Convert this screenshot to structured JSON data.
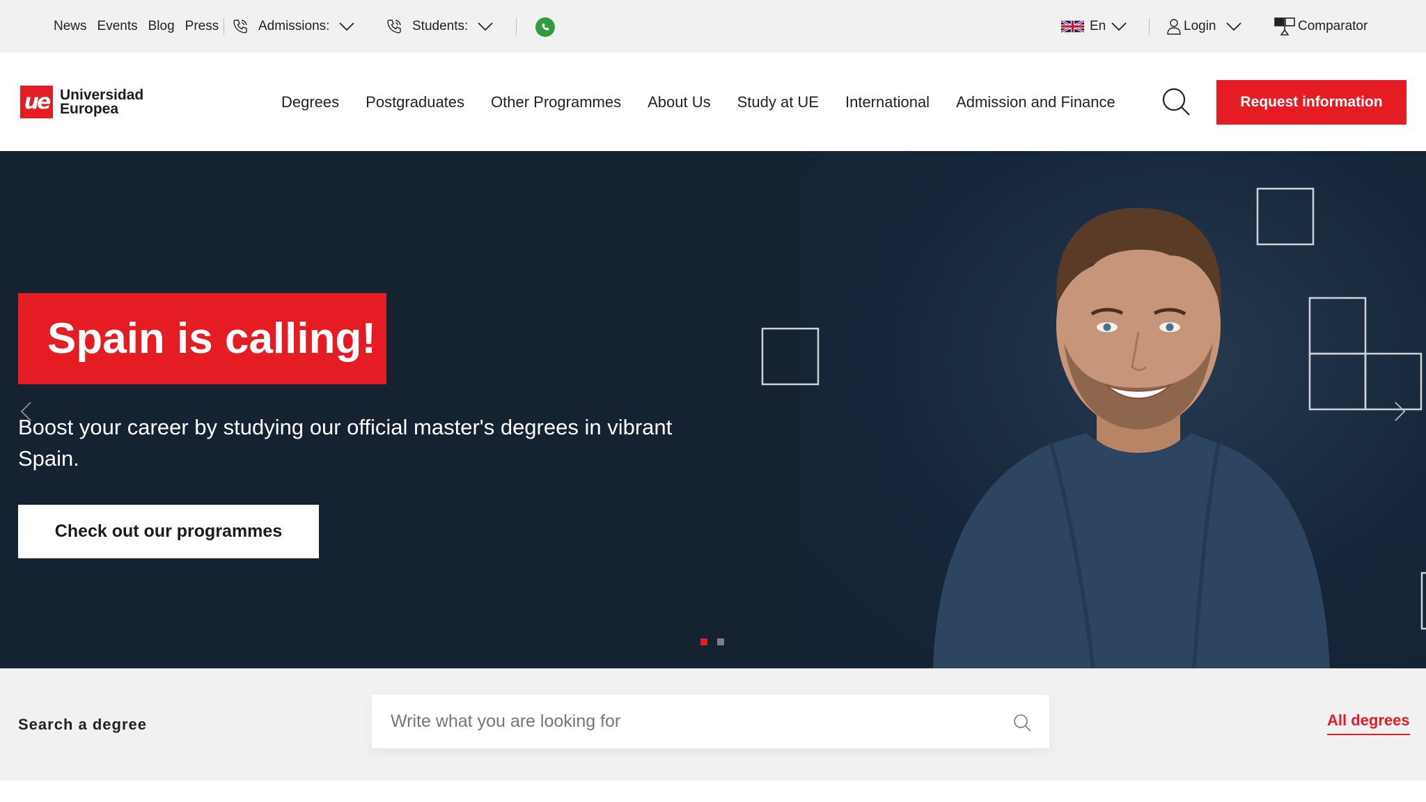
{
  "topbar": {
    "links": [
      "News",
      "Events",
      "Blog",
      "Press"
    ],
    "admissions_label": "Admissions:",
    "students_label": "Students:",
    "language": "En",
    "login": "Login",
    "comparator": "Comparator",
    "icons": {
      "phone": "phone-icon",
      "whatsapp": "whatsapp-icon",
      "flag": "uk-flag-icon",
      "user": "user-icon",
      "comparator": "comparator-icon",
      "chevron": "chevron-down-icon"
    }
  },
  "header": {
    "logo_mark": "ue",
    "logo_line1": "Universidad",
    "logo_line2": "Europea",
    "nav": [
      "Degrees",
      "Postgraduates",
      "Other Programmes",
      "About Us",
      "Study at UE",
      "International",
      "Admission and Finance"
    ],
    "request_button": "Request information"
  },
  "hero": {
    "title": "Spain is calling!",
    "subtitle": "Boost your career by studying our official master's degrees in vibrant Spain.",
    "cta": "Check out our programmes",
    "slides_total": 2,
    "active_slide": 1
  },
  "search": {
    "label": "Search a degree",
    "placeholder": "Write what you are looking for",
    "all_degrees": "All degrees"
  },
  "colors": {
    "brand_red": "#e61c24",
    "hero_bg": "#142232",
    "topbar_bg": "#f1f1f1",
    "whatsapp_green": "#2e9c3f"
  }
}
